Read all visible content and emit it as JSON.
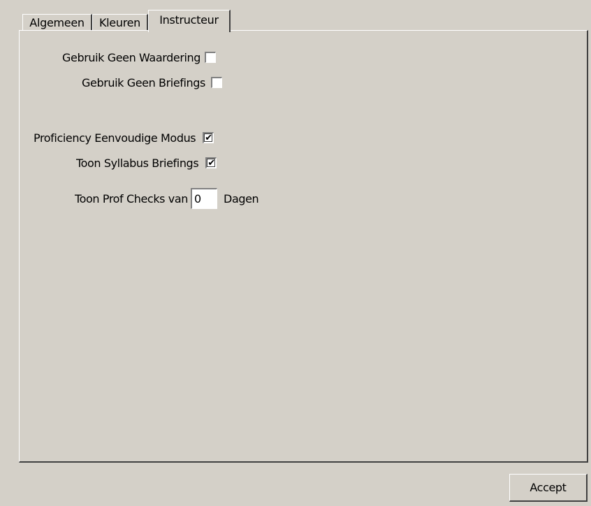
{
  "tabs": [
    {
      "label": "Algemeen"
    },
    {
      "label": "Kleuren"
    },
    {
      "label": "Instructeur"
    }
  ],
  "options": {
    "no_rating": {
      "label": "Gebruik Geen Waardering",
      "checked": false
    },
    "no_briefings": {
      "label": "Gebruik Geen Briefings",
      "checked": false
    },
    "proficiency_simple": {
      "label": "Proficiency Eenvoudige Modus",
      "checked": true
    },
    "show_syllabus_briefings": {
      "label": "Toon Syllabus Briefings",
      "checked": true
    }
  },
  "prof_checks": {
    "label": "Toon Prof Checks van",
    "value": "0",
    "unit": "Dagen"
  },
  "buttons": {
    "accept": "Accept"
  },
  "check_glyph": "✔"
}
